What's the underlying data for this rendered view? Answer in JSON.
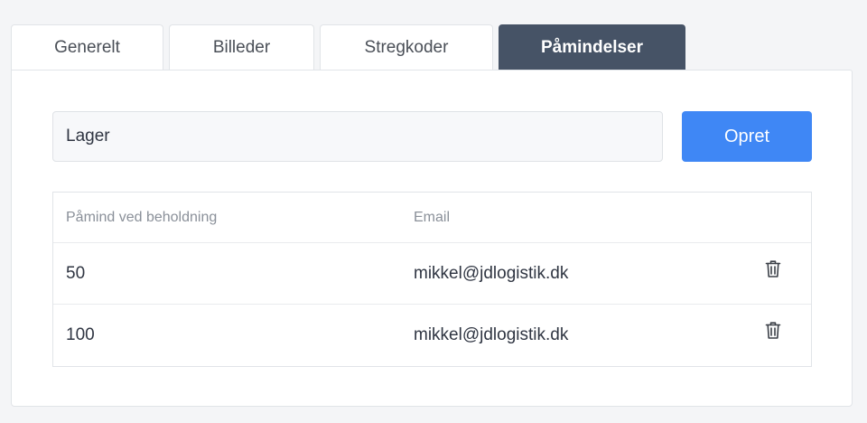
{
  "tabs": [
    {
      "label": "Generelt",
      "active": false
    },
    {
      "label": "Billeder",
      "active": false
    },
    {
      "label": "Stregkoder",
      "active": false
    },
    {
      "label": "Påmindelser",
      "active": true
    }
  ],
  "form": {
    "warehouse_value": "Lager",
    "create_label": "Opret"
  },
  "table": {
    "headers": [
      "Påmind ved beholdning",
      "Email"
    ],
    "rows": [
      {
        "threshold": "50",
        "email": "mikkel@jdlogistik.dk",
        "action_icon": "trash-icon"
      },
      {
        "threshold": "100",
        "email": "mikkel@jdlogistik.dk",
        "action_icon": "trash-icon"
      }
    ]
  },
  "colors": {
    "active_tab": "#465366",
    "primary_button": "#3f87f5",
    "page_background": "#f4f5f7"
  }
}
